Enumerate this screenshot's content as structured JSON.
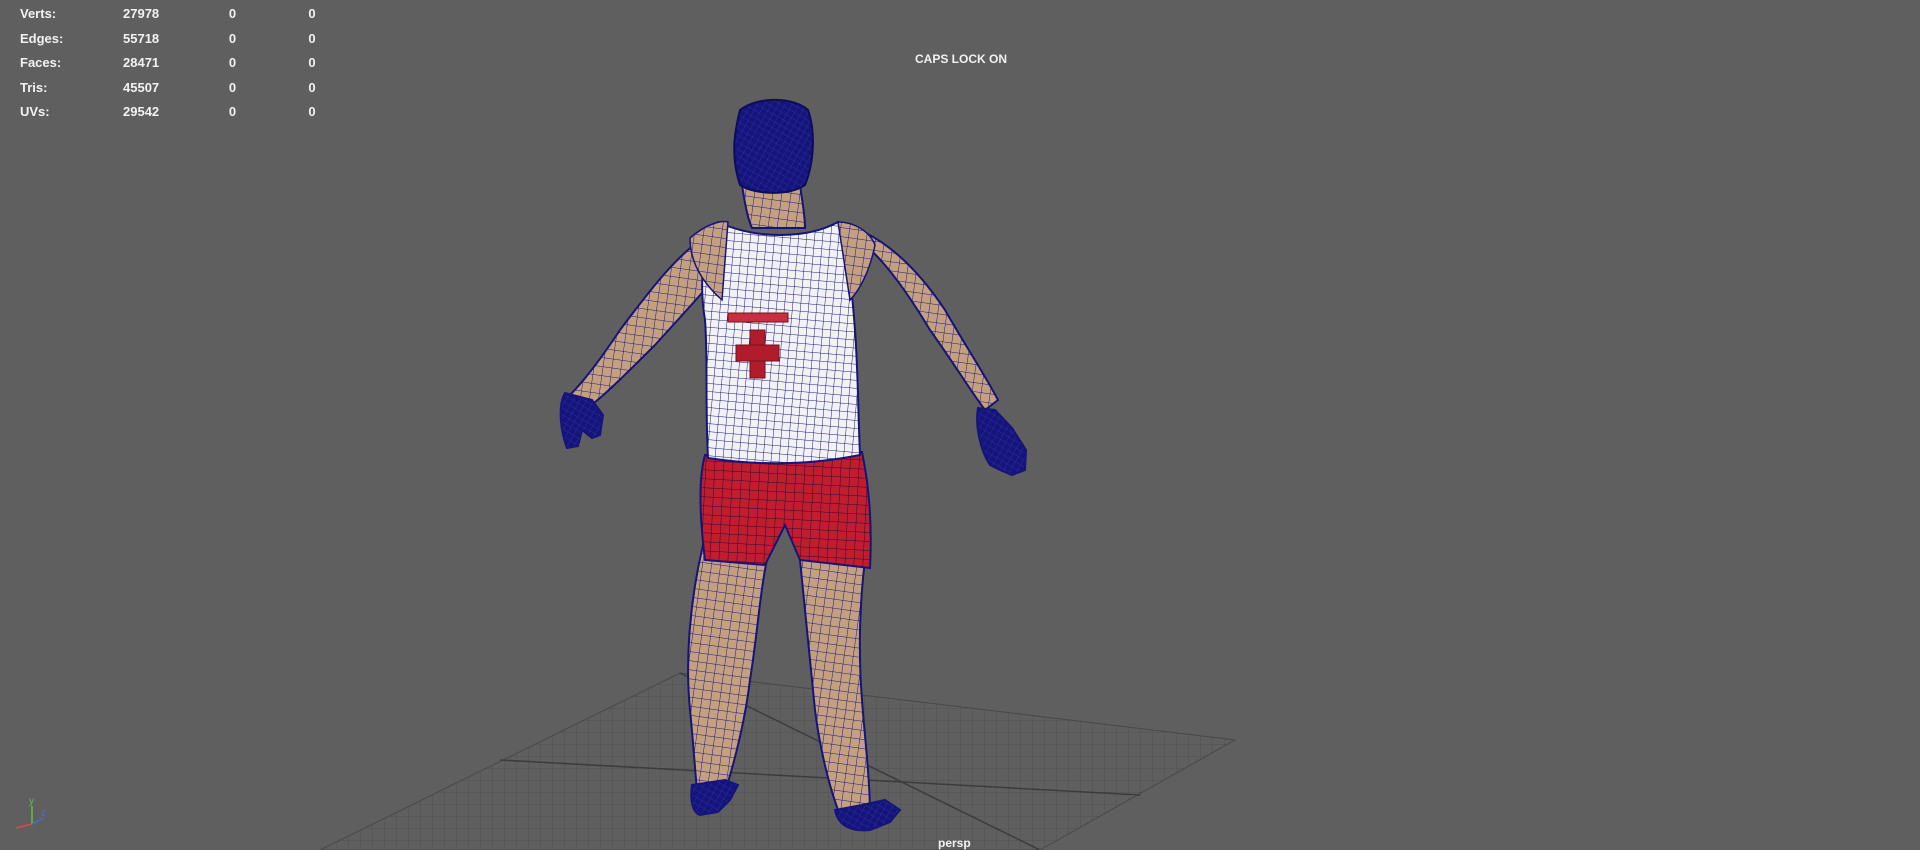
{
  "hud": {
    "rows": [
      {
        "label": "Verts:",
        "value": "27978",
        "c1": "0",
        "c2": "0"
      },
      {
        "label": "Edges:",
        "value": "55718",
        "c1": "0",
        "c2": "0"
      },
      {
        "label": "Faces:",
        "value": "28471",
        "c1": "0",
        "c2": "0"
      },
      {
        "label": "Tris:",
        "value": "45507",
        "c1": "0",
        "c2": "0"
      },
      {
        "label": "UVs:",
        "value": "29542",
        "c1": "0",
        "c2": "0"
      }
    ]
  },
  "viewport": {
    "caps_lock": "CAPS LOCK ON",
    "camera": "persp"
  },
  "axis": {
    "y": "y",
    "z": "z"
  },
  "colors": {
    "background": "#5f5f5f",
    "wire": "#14147a",
    "skin": "#c7a07e",
    "shirt": "#f4f4f4",
    "shorts": "#c41c2c",
    "grid": "#4a4a4a"
  },
  "icons": [
    "axis-gizmo-icon",
    "grid-floor-icon"
  ]
}
